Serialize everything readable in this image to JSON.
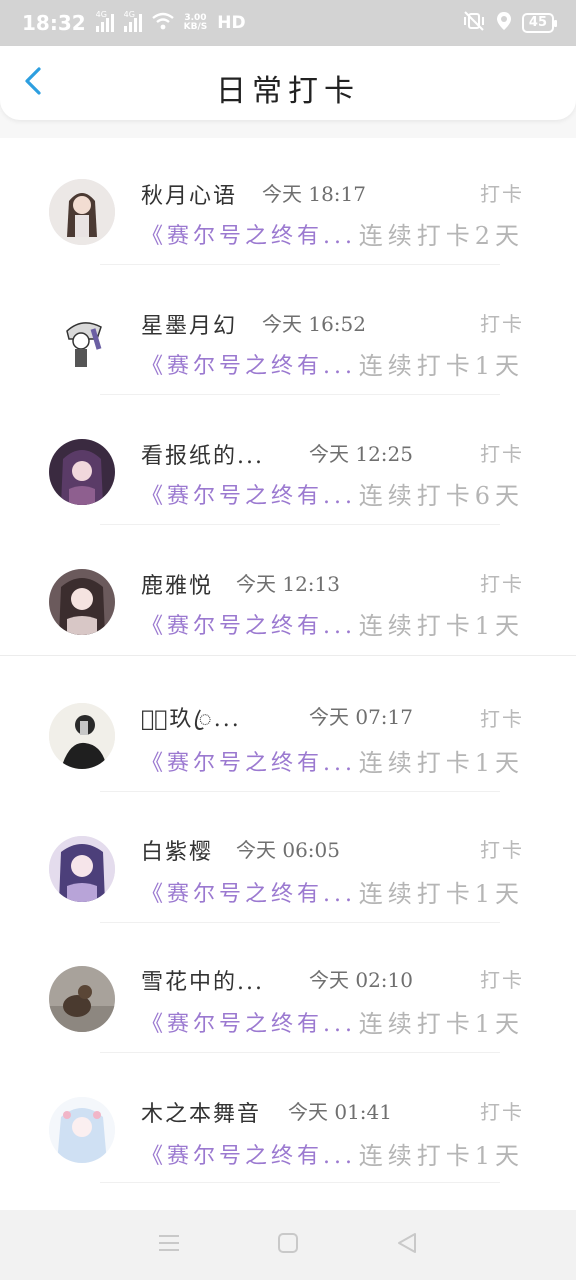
{
  "status_bar": {
    "time": "18:32",
    "signal1_label": "4G",
    "signal2_label": "4G",
    "net_speed_value": "3.00",
    "net_speed_unit": "KB/S",
    "hd_label": "HD",
    "battery": "45"
  },
  "header": {
    "title": "日常打卡",
    "back_icon": "chevron-left-icon",
    "accent_color": "#2d9fe0"
  },
  "checkins": [
    {
      "name": "秋月心语",
      "time": "今天 18:17",
      "label": "打卡",
      "topic": "《赛尔号之终有...",
      "streak": "连续打卡2天"
    },
    {
      "name": "星墨月幻",
      "time": "今天 16:52",
      "label": "打卡",
      "topic": "《赛尔号之终有...",
      "streak": "连续打卡1天"
    },
    {
      "name": "看报纸的...",
      "time": "今天 12:25",
      "label": "打卡",
      "topic": "《赛尔号之终有...",
      "streak": "连续打卡6天"
    },
    {
      "name": "鹿雅悦",
      "time": "今天 12:13",
      "label": "打卡",
      "topic": "《赛尔号之终有...",
      "streak": "连续打卡1天"
    },
    {
      "name": "𝓜ꦿ玖ꦿ...",
      "time": "今天 07:17",
      "label": "打卡",
      "topic": "《赛尔号之终有...",
      "streak": "连续打卡1天"
    },
    {
      "name": "白紫樱",
      "time": "今天 06:05",
      "label": "打卡",
      "topic": "《赛尔号之终有...",
      "streak": "连续打卡1天"
    },
    {
      "name": "雪花中的...",
      "time": "今天 02:10",
      "label": "打卡",
      "topic": "《赛尔号之终有...",
      "streak": "连续打卡1天"
    },
    {
      "name": "木之本舞音",
      "time": "今天 01:41",
      "label": "打卡",
      "topic": "《赛尔号之终有...",
      "streak": "连续打卡1天"
    }
  ],
  "colors": {
    "topic": "#9b79d0",
    "streak": "#b5b5b5",
    "label": "#b9b9b9"
  },
  "nav_bar": {
    "icons": [
      "menu-icon",
      "home-square-icon",
      "back-triangle-icon"
    ]
  }
}
